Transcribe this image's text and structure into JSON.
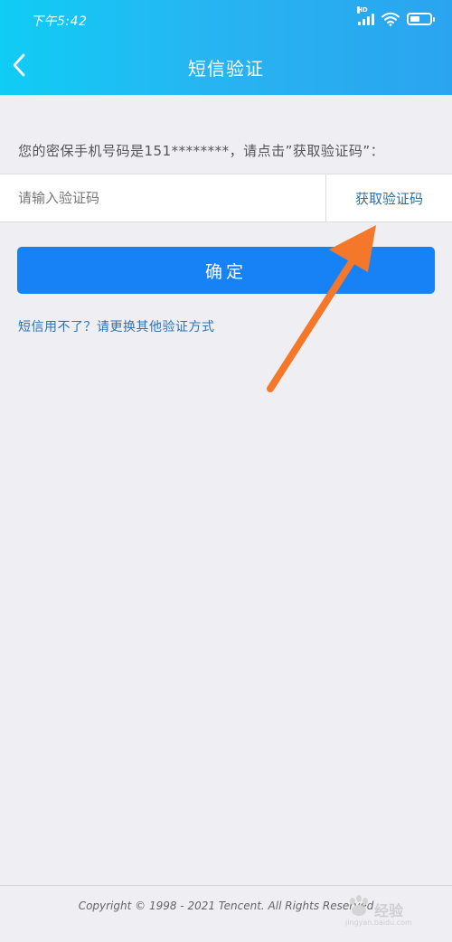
{
  "status_bar": {
    "time": "下午5:42",
    "network_label": "HD",
    "battery_level": 0.4,
    "icons": [
      "signal-icon",
      "wifi-icon",
      "battery-icon"
    ]
  },
  "header": {
    "title": "短信验证",
    "back_icon": "chevron-left-icon"
  },
  "prompt_text": "您的密保手机号码是151********，请点击”获取验证码”：",
  "verify": {
    "input_placeholder": "请输入验证码",
    "input_value": "",
    "get_code_label": "获取验证码"
  },
  "confirm_label": "确定",
  "alt_link": "短信用不了？请更换其他验证方式",
  "footer": {
    "copyright": "Copyright © 1998 - 2021 Tencent. All Rights Reserved"
  },
  "watermark": {
    "brand": "经验",
    "sub": "jingyan.baidu.com"
  },
  "colors": {
    "header_gradient_start": "#0fcdf5",
    "header_gradient_end": "#2aa4ef",
    "primary_button": "#1782f6",
    "link": "#2c73b7",
    "annotation_arrow": "#f5782a",
    "background": "#efeef3"
  }
}
